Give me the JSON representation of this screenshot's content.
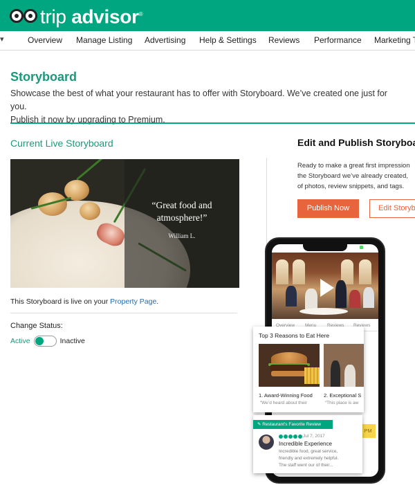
{
  "brand": {
    "logo_text_regular": "trip",
    "logo_text_bold": "advisor",
    "trademark": "®"
  },
  "nav": {
    "caret": "▾",
    "items": [
      "Overview",
      "Manage Listing",
      "Advertising",
      "Help & Settings",
      "Reviews",
      "Performance",
      "Marketing To"
    ]
  },
  "header": {
    "title": "Storyboard",
    "description_line1": "Showcase the best of what your restaurant has to offer with Storyboard. We’ve created one just for you.",
    "description_line2": "Publish it now by upgrading to Premium."
  },
  "live": {
    "title": "Current Live Storyboard",
    "quote": "“Great food and atmosphere!”",
    "quote_author": "William L.",
    "status_prefix": "This Storyboard is live on your ",
    "status_link": "Property Page",
    "status_suffix": ".",
    "change_status_label": "Change Status:",
    "toggle_active_label": "Active",
    "toggle_inactive_label": "Inactive"
  },
  "edit": {
    "title": "Edit and Publish Storyboa",
    "desc_line1": "Ready to make a great first impression",
    "desc_line2": "the Storyboard we’ve already created,",
    "desc_line3": "of photos, review snippets, and tags.",
    "publish_button": "Publish Now",
    "edit_button": "Edit Storyb"
  },
  "phone": {
    "tabs": [
      "Overview",
      "Menu",
      "Reviews",
      "Reviews"
    ],
    "pm_badge": "PM",
    "reasons_title": "Top 3 Reasons to Eat Here",
    "reason1": "1. Award-Winning Food",
    "reason2": "2. Exceptional S",
    "reason1_snippet": "“We’d heard about their",
    "reason2_snippet": "“This place is aw",
    "fav_badge": "✎ Restaurant's Favorite Review",
    "review_date": "Jul 7, 2017",
    "review_title": "Incredible Experience",
    "review_body_1": "Incredible food, great service,",
    "review_body_2": "friendly and extremely helpful.",
    "review_body_3": "The staff went our of their..."
  },
  "colors": {
    "brand_green": "#00a680",
    "title_green": "#1a9a7c",
    "publish_orange": "#e8643c",
    "link_blue": "#1f6bb0"
  }
}
